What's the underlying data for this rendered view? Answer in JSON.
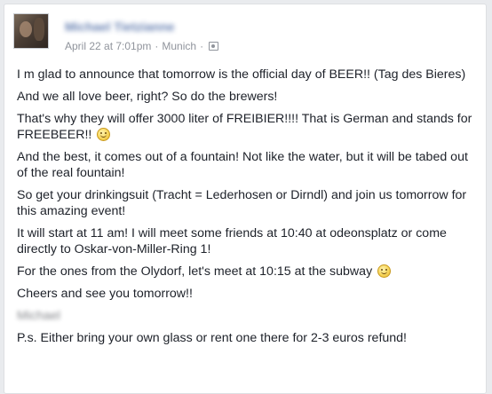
{
  "post": {
    "author": "Michael Tietzianne",
    "date": "April 22 at 7:01pm",
    "location": "Munich",
    "separator": "·",
    "audience_icon": "friends-icon",
    "paragraphs": [
      "I m glad to announce that tomorrow is the official day of BEER!! (Tag des Bieres)",
      "And we all love beer, right? So do the brewers!",
      "That's why they will offer 3000 liter of FREIBIER!!!! That is German and stands for FREEBEER!!",
      "And the best, it comes out of a fountain! Not like the water, but it will be tabed out of the real fountain!",
      "So get your drinkingsuit (Tracht = Lederhosen or Dirndl) and join us tomorrow for this amazing event!",
      "It will start at 11 am! I will meet some friends at 10:40 at odeonsplatz or come directly to Oskar-von-Miller-Ring 1!",
      "For the ones from the Olydorf, let's meet at 10:15 at the subway",
      "Cheers and see you tomorrow!!",
      "Michael",
      "P.s. Either bring your own glass or rent one there for 2-3 euros refund!"
    ]
  },
  "colors": {
    "name_link": "#365899",
    "meta_text": "#90949c",
    "body_text": "#1d2129",
    "background": "#e9ebee"
  }
}
